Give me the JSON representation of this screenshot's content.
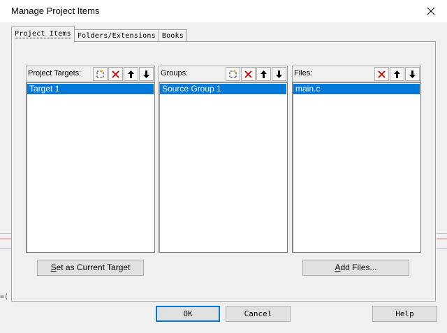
{
  "window": {
    "title": "Manage Project Items"
  },
  "tabs": [
    {
      "label": "Project Items",
      "active": true
    },
    {
      "label": "Folders/Extensions",
      "active": false
    },
    {
      "label": "Books",
      "active": false
    }
  ],
  "panels": {
    "targets": {
      "label": "Project Targets:",
      "tools": [
        "new-icon",
        "delete-icon",
        "move-up-icon",
        "move-down-icon"
      ],
      "items": [
        "Target 1"
      ]
    },
    "groups": {
      "label": "Groups:",
      "tools": [
        "new-icon",
        "delete-icon",
        "move-up-icon",
        "move-down-icon"
      ],
      "items": [
        "Source Group 1"
      ]
    },
    "files": {
      "label": "Files:",
      "tools": [
        "delete-icon",
        "move-up-icon",
        "move-down-icon"
      ],
      "items": [
        "main.c"
      ]
    }
  },
  "buttons": {
    "set_current_prefix": "S",
    "set_current_rest": "et as Current Target",
    "add_files_prefix": "A",
    "add_files_rest": "dd Files...",
    "ok": "OK",
    "cancel": "Cancel",
    "help": "Help"
  },
  "colors": {
    "selection": "#0078d7",
    "delete_red": "#c00000",
    "dialog_bg": "#f0f0f0"
  }
}
